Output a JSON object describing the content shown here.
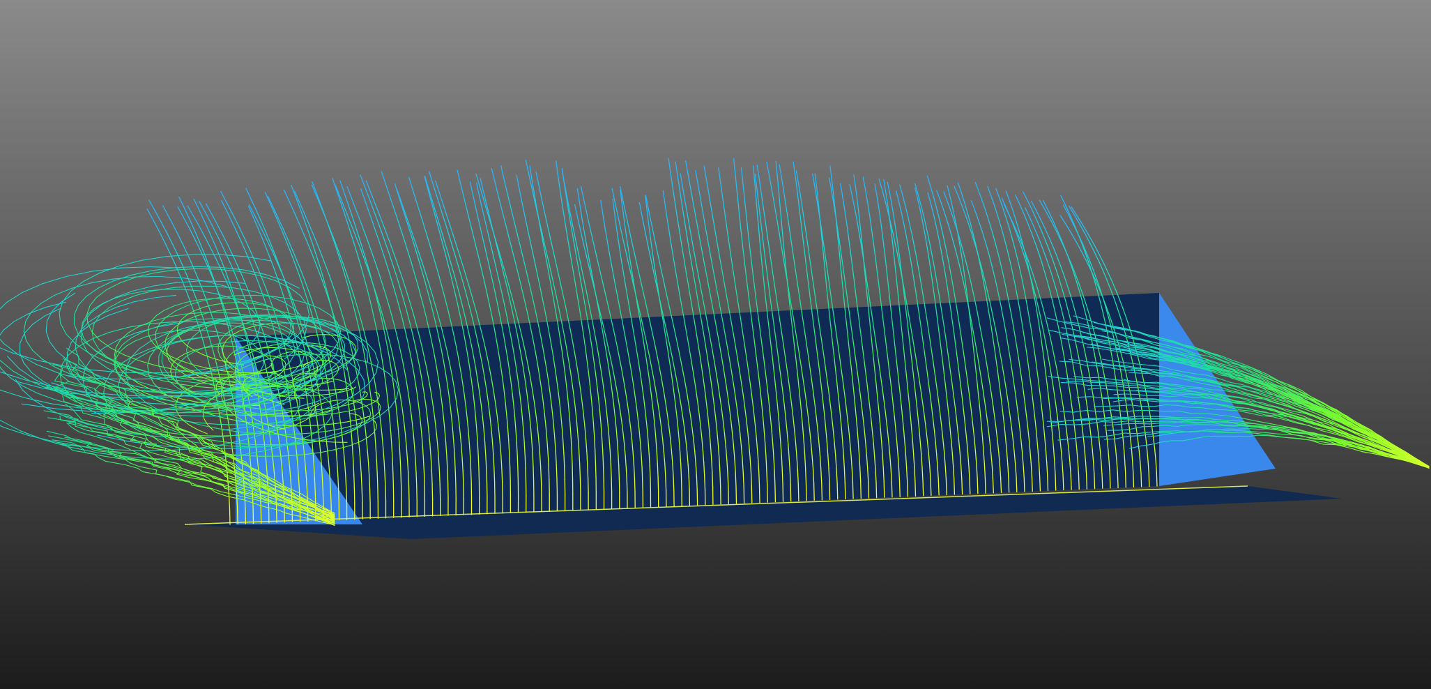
{
  "scene": {
    "background": {
      "top_color": "#8a8a8a",
      "bottom_color": "#1c1c1c"
    },
    "geometry": {
      "floor_color": "#112a52",
      "back_wall_color": "#0f2a55",
      "side_face_color": "#3b8cf5"
    },
    "streamlines": {
      "colormap": [
        "#f5ff2a",
        "#7dff2a",
        "#22e08a",
        "#1fd6d0",
        "#2ab0ff"
      ],
      "colormap_stops": [
        0,
        0.25,
        0.5,
        0.75,
        1
      ]
    }
  }
}
